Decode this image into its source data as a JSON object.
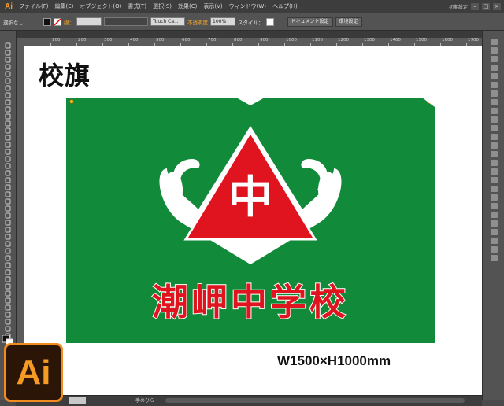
{
  "menubar": {
    "app_logo": "Ai",
    "items": [
      "ファイル(F)",
      "編集(E)",
      "オブジェクト(O)",
      "書式(T)",
      "選択(S)",
      "効果(C)",
      "表示(V)",
      "ウィンドウ(W)",
      "ヘルプ(H)"
    ],
    "workspace_label": "初期設定",
    "window_controls": [
      "–",
      "□",
      "×"
    ]
  },
  "control_bar": {
    "selection_label": "選択なし",
    "stroke_label": "線：",
    "brush_label": "Touch Ca...",
    "opacity_label": "不透明度",
    "opacity_value": "100%",
    "style_label": "スタイル：",
    "document_setup_button": "ドキュメント設定",
    "preferences_button": "環境設定"
  },
  "ruler": {
    "ticks": [
      "100",
      "200",
      "300",
      "400",
      "500",
      "600",
      "700",
      "800",
      "900",
      "1000",
      "1100",
      "1200",
      "1300",
      "1400",
      "1500",
      "1600",
      "1700"
    ]
  },
  "artwork": {
    "title": "校旗",
    "flag_character": "中",
    "school_name": "潮岬中学校",
    "dimensions": "W1500×H1000mm",
    "colors": {
      "flag_green": "#118a3a",
      "emblem_red": "#e0141e",
      "emblem_white": "#ffffff",
      "grommet": "#e8c23a"
    }
  },
  "status_bar": {
    "zoom_value": "",
    "tool_name": "手のひら"
  },
  "badge": {
    "logo_text": "Ai"
  }
}
